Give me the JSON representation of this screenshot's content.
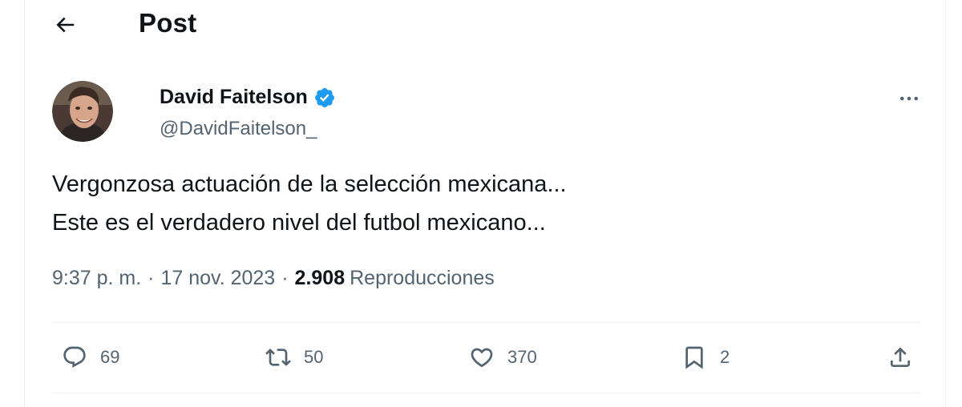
{
  "header": {
    "back_icon": "arrow-left-icon",
    "title": "Post"
  },
  "author": {
    "name": "David Faitelson",
    "handle": "@DavidFaitelson_",
    "verified_icon": "verified-badge-icon",
    "verified_color": "#1d9bf0"
  },
  "more_icon": "more-horizontal-icon",
  "post": {
    "lines": [
      "Vergonzosa actuación de la selección mexicana...",
      "Este es el verdadero nivel del futbol mexicano..."
    ]
  },
  "meta": {
    "time": "9:37 p. m.",
    "separator": "·",
    "date": "17 nov. 2023",
    "views_count": "2.908",
    "views_label": "Reproducciones"
  },
  "actions": {
    "reply": {
      "icon": "reply-icon",
      "count": "69"
    },
    "repost": {
      "icon": "repost-icon",
      "count": "50"
    },
    "like": {
      "icon": "heart-icon",
      "count": "370"
    },
    "bookmark": {
      "icon": "bookmark-icon",
      "count": "2"
    },
    "share": {
      "icon": "share-icon"
    }
  },
  "colors": {
    "text_primary": "#0f1419",
    "text_secondary": "#536471",
    "divider": "#eff3f4"
  }
}
